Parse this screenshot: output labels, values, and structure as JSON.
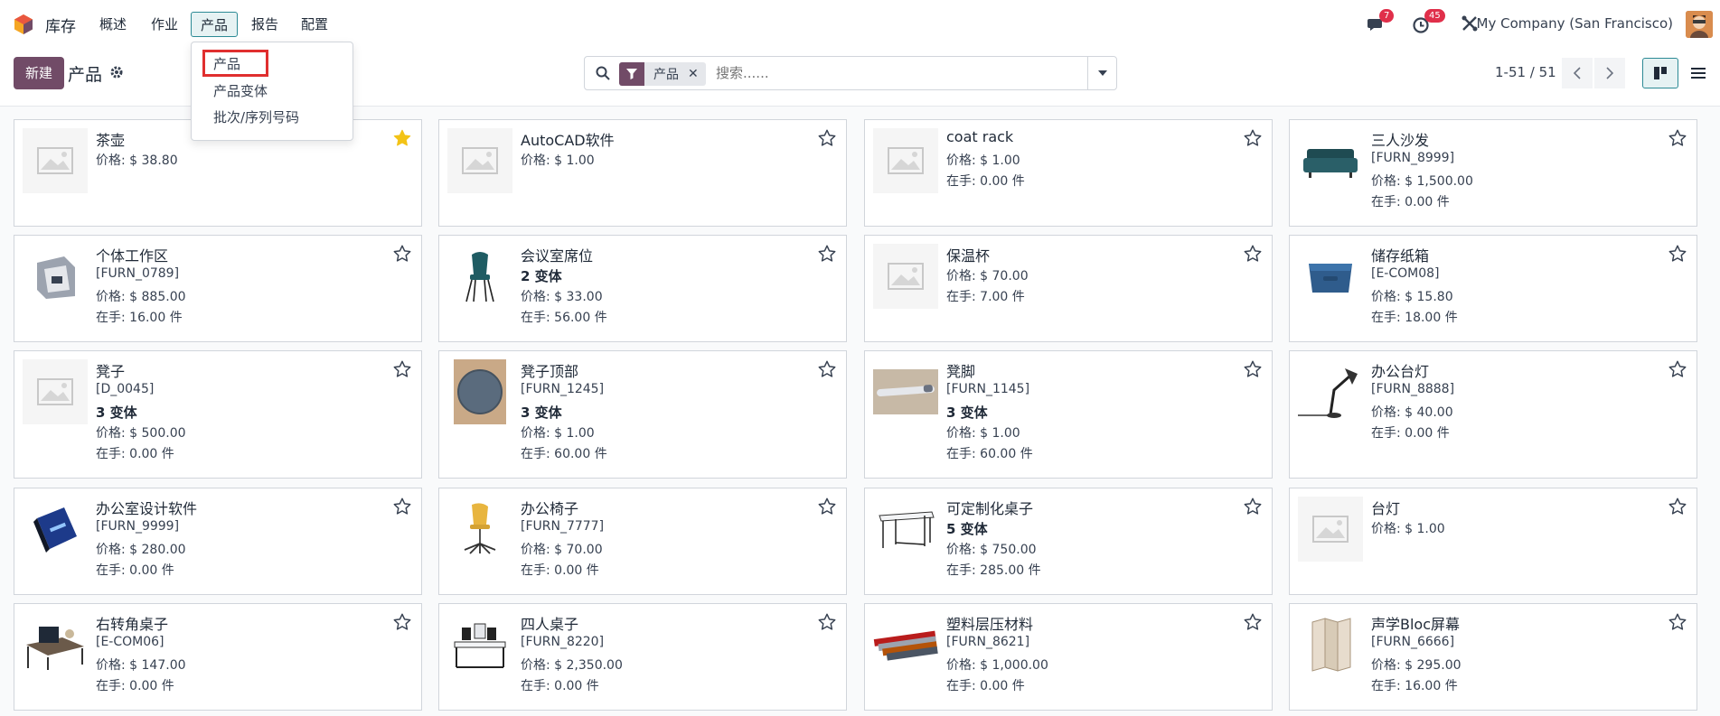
{
  "app": {
    "name": "库存"
  },
  "nav": {
    "menus": [
      "概述",
      "作业",
      "产品",
      "报告",
      "配置"
    ],
    "messages_badge": "7",
    "activities_badge": "45",
    "company": "My Company (San Francisco)"
  },
  "control": {
    "new_label": "新建",
    "title": "产品",
    "facet": "产品",
    "search_placeholder": "搜索......",
    "pager": "1-51 / 51"
  },
  "dropdown": {
    "items": [
      "产品",
      "产品变体",
      "批次/序列号码"
    ]
  },
  "products": [
    {
      "name": "茶壶",
      "lines": [
        "价格: $ 38.80"
      ],
      "starred": true,
      "image": "placeholder"
    },
    {
      "name": "AutoCAD软件",
      "lines": [
        "价格: $ 1.00"
      ],
      "starred": false,
      "image": "placeholder"
    },
    {
      "name": "coat rack",
      "lines": [
        "价格: $ 1.00",
        "在手:   0.00 件"
      ],
      "starred": false,
      "image": "placeholder"
    },
    {
      "name": "三人沙发",
      "lines": [
        "[FURN_8999]",
        "价格: $ 1,500.00",
        "在手:   0.00 件"
      ],
      "starred": false,
      "image": "sofa"
    },
    {
      "name": "个体工作区",
      "lines": [
        "[FURN_0789]",
        "价格: $ 885.00",
        "在手:   16.00 件"
      ],
      "starred": false,
      "image": "workspace"
    },
    {
      "name": "会议室席位",
      "bold": "2 变体",
      "lines": [
        "价格: $ 33.00",
        "在手:   56.00 件"
      ],
      "starred": false,
      "image": "chair-teal"
    },
    {
      "name": "保温杯",
      "lines": [
        "价格: $ 70.00",
        "在手:   7.00 件"
      ],
      "starred": false,
      "image": "placeholder"
    },
    {
      "name": "储存纸箱",
      "lines": [
        "[E-COM08]",
        "价格: $ 15.80",
        "在手:   18.00 件"
      ],
      "starred": false,
      "image": "box"
    },
    {
      "name": "凳子",
      "lines": [
        "[D_0045]"
      ],
      "bold": "3 变体",
      "lines2": [
        "价格: $ 500.00",
        "在手:   0.00 件"
      ],
      "starred": false,
      "image": "placeholder"
    },
    {
      "name": "凳子顶部",
      "lines": [
        "[FURN_1245]"
      ],
      "bold": "3 变体",
      "lines2": [
        "价格: $ 1.00",
        "在手:   60.00 件"
      ],
      "starred": false,
      "image": "stool-top"
    },
    {
      "name": "凳脚",
      "lines": [
        "[FURN_1145]"
      ],
      "bold": "3 变体",
      "lines2": [
        "价格: $ 1.00",
        "在手:   60.00 件"
      ],
      "starred": false,
      "image": "stool-leg"
    },
    {
      "name": "办公台灯",
      "lines": [
        "[FURN_8888]",
        "价格: $ 40.00",
        "在手:   0.00 件"
      ],
      "starred": false,
      "image": "lamp"
    },
    {
      "name": "办公室设计软件",
      "lines": [
        "[FURN_9999]",
        "价格: $ 280.00",
        "在手:   0.00 件"
      ],
      "starred": false,
      "image": "software"
    },
    {
      "name": "办公椅子",
      "lines": [
        "[FURN_7777]",
        "价格: $ 70.00",
        "在手:   0.00 件"
      ],
      "starred": false,
      "image": "chair-yellow"
    },
    {
      "name": "可定制化桌子",
      "bold": "5 变体",
      "lines": [
        "价格: $ 750.00",
        "在手:   285.00 件"
      ],
      "starred": false,
      "image": "desk"
    },
    {
      "name": "台灯",
      "lines": [
        "价格: $ 1.00"
      ],
      "starred": false,
      "image": "placeholder"
    },
    {
      "name": "右转角桌子",
      "lines": [
        "[E-COM06]",
        "价格: $ 147.00",
        "在手:   0.00 件"
      ],
      "starred": false,
      "image": "corner-desk"
    },
    {
      "name": "四人桌子",
      "lines": [
        "[FURN_8220]",
        "价格: $ 2,350.00",
        "在手:   0.00 件"
      ],
      "starred": false,
      "image": "table4"
    },
    {
      "name": "塑料层压材料",
      "lines": [
        "[FURN_8621]",
        "价格: $ 1,000.00",
        "在手:   0.00 件"
      ],
      "starred": false,
      "image": "laminate"
    },
    {
      "name": "声学Bloc屏幕",
      "lines": [
        "[FURN_6666]",
        "价格: $ 295.00",
        "在手:   16.00 件"
      ],
      "starred": false,
      "image": "screen"
    }
  ],
  "colors": {
    "brand": "#714b67",
    "accent": "#2c8a95",
    "star_on": "#f3c316",
    "badge": "#e02f4a"
  }
}
